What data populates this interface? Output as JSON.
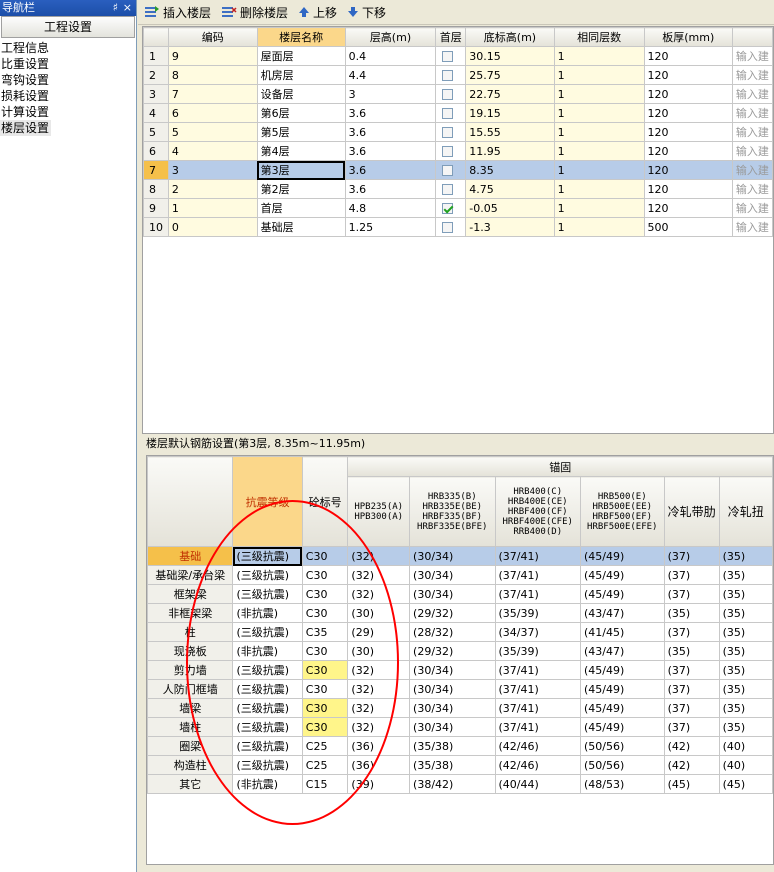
{
  "nav": {
    "title": "导航栏",
    "pin_glyph": "♯",
    "close_glyph": "×",
    "header": "工程设置",
    "items": [
      "工程信息",
      "比重设置",
      "弯钩设置",
      "损耗设置",
      "计算设置",
      "楼层设置"
    ]
  },
  "toolbar": {
    "insert_label": "插入楼层",
    "delete_label": "删除楼层",
    "up_label": "上移",
    "down_label": "下移"
  },
  "floor_table": {
    "headers": [
      "编码",
      "楼层名称",
      "层高(m)",
      "首层",
      "底标高(m)",
      "相同层数",
      "板厚(mm)",
      ""
    ],
    "rows": [
      {
        "n": "1",
        "code": "9",
        "name": "屋面层",
        "height": "0.4",
        "first": false,
        "base": "30.15",
        "same": "1",
        "slab": "120",
        "note": "输入建"
      },
      {
        "n": "2",
        "code": "8",
        "name": "机房层",
        "height": "4.4",
        "first": false,
        "base": "25.75",
        "same": "1",
        "slab": "120",
        "note": "输入建"
      },
      {
        "n": "3",
        "code": "7",
        "name": "设备层",
        "height": "3",
        "first": false,
        "base": "22.75",
        "same": "1",
        "slab": "120",
        "note": "输入建"
      },
      {
        "n": "4",
        "code": "6",
        "name": "第6层",
        "height": "3.6",
        "first": false,
        "base": "19.15",
        "same": "1",
        "slab": "120",
        "note": "输入建"
      },
      {
        "n": "5",
        "code": "5",
        "name": "第5层",
        "height": "3.6",
        "first": false,
        "base": "15.55",
        "same": "1",
        "slab": "120",
        "note": "输入建"
      },
      {
        "n": "6",
        "code": "4",
        "name": "第4层",
        "height": "3.6",
        "first": false,
        "base": "11.95",
        "same": "1",
        "slab": "120",
        "note": "输入建"
      },
      {
        "n": "7",
        "code": "3",
        "name": "第3层",
        "height": "3.6",
        "first": false,
        "base": "8.35",
        "same": "1",
        "slab": "120",
        "note": "输入建"
      },
      {
        "n": "8",
        "code": "2",
        "name": "第2层",
        "height": "3.6",
        "first": false,
        "base": "4.75",
        "same": "1",
        "slab": "120",
        "note": "输入建"
      },
      {
        "n": "9",
        "code": "1",
        "name": "首层",
        "height": "4.8",
        "first": true,
        "base": "-0.05",
        "same": "1",
        "slab": "120",
        "note": "输入建"
      },
      {
        "n": "10",
        "code": "0",
        "name": "基础层",
        "height": "1.25",
        "first": false,
        "base": "-1.3",
        "same": "1",
        "slab": "500",
        "note": "输入建"
      }
    ]
  },
  "rebar_section": {
    "title": "楼层默认钢筋设置(第3层, 8.35m~11.95m)",
    "group_header": "锚固",
    "col_seismic": "抗震等级",
    "col_concrete": "砼标号",
    "steel_headers": [
      "HPB235(A)\nHPB300(A)",
      "HRB335(B)\nHRB335E(BE)\nHRBF335(BF)\nHRBF335E(BFE)",
      "HRB400(C)\nHRB400E(CE)\nHRBF400(CF)\nHRBF400E(CFE)\nRRB400(D)",
      "HRB500(E)\nHRB500E(EE)\nHRBF500(EF)\nHRBF500E(EFE)",
      "冷轧带肋",
      "冷轧扭"
    ],
    "rows": [
      {
        "name": "基础",
        "seismic": "(三级抗震)",
        "concrete": "C30",
        "v": [
          "(32)",
          "(30/34)",
          "(37/41)",
          "(45/49)",
          "(37)",
          "(35)"
        ],
        "yl": false
      },
      {
        "name": "基础梁/承台梁",
        "seismic": "(三级抗震)",
        "concrete": "C30",
        "v": [
          "(32)",
          "(30/34)",
          "(37/41)",
          "(45/49)",
          "(37)",
          "(35)"
        ],
        "yl": false
      },
      {
        "name": "框架梁",
        "seismic": "(三级抗震)",
        "concrete": "C30",
        "v": [
          "(32)",
          "(30/34)",
          "(37/41)",
          "(45/49)",
          "(37)",
          "(35)"
        ],
        "yl": false
      },
      {
        "name": "非框架梁",
        "seismic": "(非抗震)",
        "concrete": "C30",
        "v": [
          "(30)",
          "(29/32)",
          "(35/39)",
          "(43/47)",
          "(35)",
          "(35)"
        ],
        "yl": false
      },
      {
        "name": "柱",
        "seismic": "(三级抗震)",
        "concrete": "C35",
        "v": [
          "(29)",
          "(28/32)",
          "(34/37)",
          "(41/45)",
          "(37)",
          "(35)"
        ],
        "yl": false
      },
      {
        "name": "现浇板",
        "seismic": "(非抗震)",
        "concrete": "C30",
        "v": [
          "(30)",
          "(29/32)",
          "(35/39)",
          "(43/47)",
          "(35)",
          "(35)"
        ],
        "yl": false
      },
      {
        "name": "剪力墙",
        "seismic": "(三级抗震)",
        "concrete": "C30",
        "v": [
          "(32)",
          "(30/34)",
          "(37/41)",
          "(45/49)",
          "(37)",
          "(35)"
        ],
        "yl": true
      },
      {
        "name": "人防门框墙",
        "seismic": "(三级抗震)",
        "concrete": "C30",
        "v": [
          "(32)",
          "(30/34)",
          "(37/41)",
          "(45/49)",
          "(37)",
          "(35)"
        ],
        "yl": false
      },
      {
        "name": "墙梁",
        "seismic": "(三级抗震)",
        "concrete": "C30",
        "v": [
          "(32)",
          "(30/34)",
          "(37/41)",
          "(45/49)",
          "(37)",
          "(35)"
        ],
        "yl": true
      },
      {
        "name": "墙柱",
        "seismic": "(三级抗震)",
        "concrete": "C30",
        "v": [
          "(32)",
          "(30/34)",
          "(37/41)",
          "(45/49)",
          "(37)",
          "(35)"
        ],
        "yl": true
      },
      {
        "name": "圈梁",
        "seismic": "(三级抗震)",
        "concrete": "C25",
        "v": [
          "(36)",
          "(35/38)",
          "(42/46)",
          "(50/56)",
          "(42)",
          "(40)"
        ],
        "yl": false
      },
      {
        "name": "构造柱",
        "seismic": "(三级抗震)",
        "concrete": "C25",
        "v": [
          "(36)",
          "(35/38)",
          "(42/46)",
          "(50/56)",
          "(42)",
          "(40)"
        ],
        "yl": false
      },
      {
        "name": "其它",
        "seismic": "(非抗震)",
        "concrete": "C15",
        "v": [
          "(39)",
          "(38/42)",
          "(40/44)",
          "(48/53)",
          "(45)",
          "(45)"
        ],
        "yl": false
      }
    ]
  },
  "colors": {
    "accent": "#fbd78a",
    "selected_row": "#b7cce8",
    "highlight": "#fff58a",
    "annotation": "#ff0000"
  }
}
